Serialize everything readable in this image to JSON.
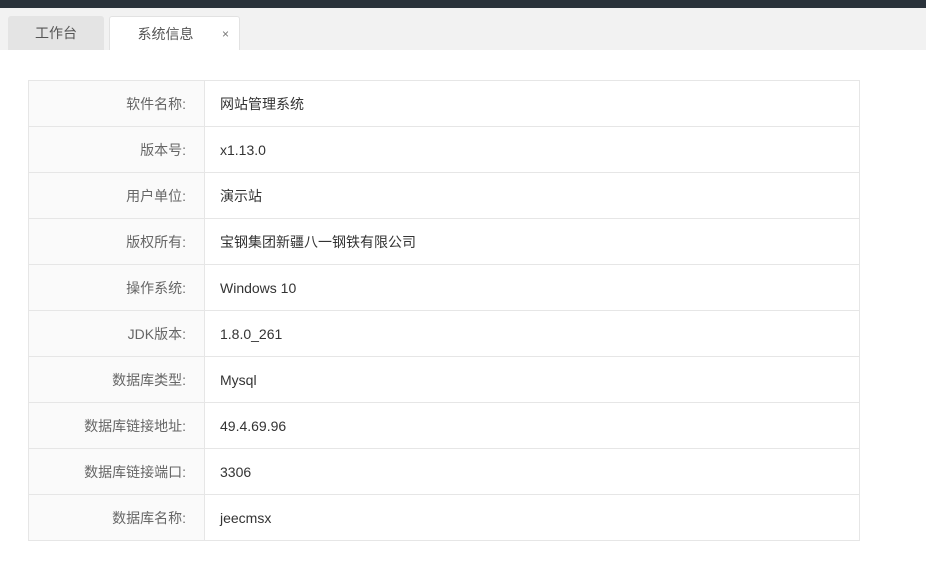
{
  "tabs": [
    {
      "label": "工作台"
    },
    {
      "label": "系统信息",
      "close": "×"
    }
  ],
  "rows": [
    {
      "label": "软件名称:",
      "value": "网站管理系统"
    },
    {
      "label": "版本号:",
      "value": "x1.13.0"
    },
    {
      "label": "用户单位:",
      "value": "演示站"
    },
    {
      "label": "版权所有:",
      "value": "宝钢集团新疆八一钢铁有限公司"
    },
    {
      "label": "操作系统:",
      "value": "Windows 10"
    },
    {
      "label": "JDK版本:",
      "value": "1.8.0_261"
    },
    {
      "label": "数据库类型:",
      "value": "Mysql"
    },
    {
      "label": "数据库链接地址:",
      "value": "49.4.69.96"
    },
    {
      "label": "数据库链接端口:",
      "value": "3306"
    },
    {
      "label": "数据库名称:",
      "value": "jeecmsx"
    }
  ]
}
